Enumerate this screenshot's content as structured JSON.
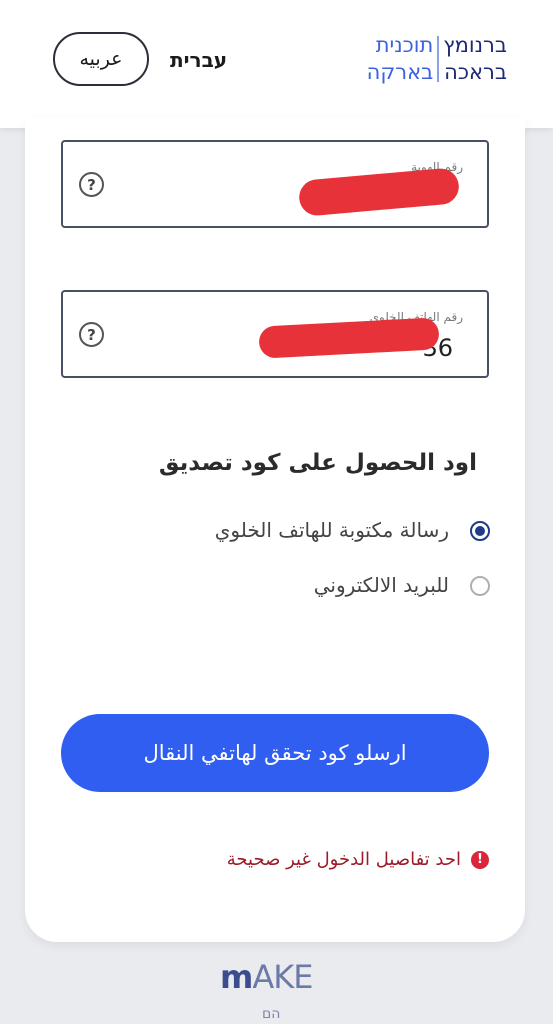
{
  "header": {
    "logo": {
      "line1_left": "תוכנית",
      "line1_right": "ברנומץ",
      "line2_left": "בארקה",
      "line2_right": "בראכה"
    },
    "lang_hebrew": "עברית",
    "lang_arabic": "عربيه"
  },
  "form": {
    "id_field": {
      "label": "رقم الهوية",
      "value": "",
      "help_icon": "question-circle-icon"
    },
    "phone_field": {
      "label": "رقم الهاتف الخلوي",
      "value": "36",
      "help_icon": "question-circle-icon"
    },
    "verification_title": "اود الحصول على كود تصديق",
    "options": [
      {
        "label": "رسالة مكتوبة للهاتف الخلوي",
        "checked": true
      },
      {
        "label": "للبريد الالكتروني",
        "checked": false
      }
    ],
    "submit_label": "ارسلو كود تحقق لهاتفي النقال",
    "error_message": "احد تفاصيل الدخول غير صحيحة"
  },
  "footer": {
    "logo_text": "AKE",
    "sub_text": "הם"
  },
  "colors": {
    "primary_button": "#2f5ef0",
    "error": "#d9263a",
    "redaction": "#e8323a"
  }
}
